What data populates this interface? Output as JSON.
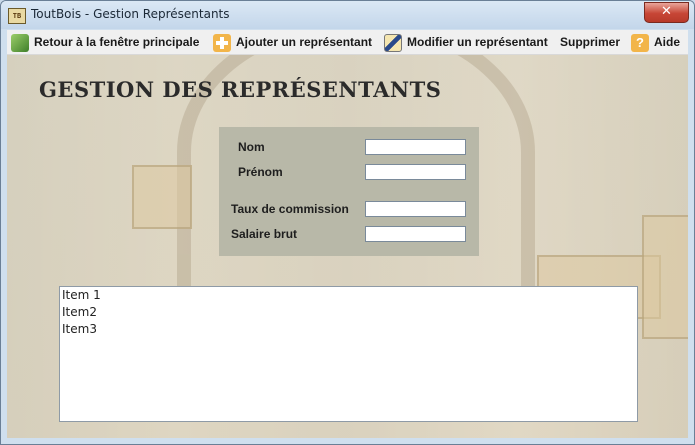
{
  "window": {
    "title": "ToutBois - Gestion Représentants",
    "app_icon_text": "TB",
    "close_label": "✕"
  },
  "toolbar": {
    "items": [
      {
        "label": "Retour à la fenêtre principale",
        "icon": "return-home-icon",
        "color": "#5a9a3a"
      },
      {
        "label": "Ajouter un représentant",
        "icon": "add-plus-icon",
        "color": "#e8a23a"
      },
      {
        "label": "Modifier un représentant",
        "icon": "edit-pencil-icon",
        "color": "#3a5a9a"
      },
      {
        "label": "Supprimer",
        "icon": "",
        "color": ""
      },
      {
        "label": "Aide",
        "icon": "help-question-icon",
        "color": "#e8a23a"
      }
    ]
  },
  "main": {
    "heading": "Gestion des représentants",
    "form": {
      "nom_label": "Nom",
      "prenom_label": "Prénom",
      "taux_label": "Taux de commission",
      "salaire_label": "Salaire brut",
      "nom_value": "",
      "prenom_value": "",
      "taux_value": "",
      "salaire_value": ""
    },
    "list": [
      "Item 1",
      "Item2",
      "Item3"
    ]
  },
  "colors": {
    "form_panel_bg": "#b8b8a8",
    "close_button": "#c74636"
  }
}
